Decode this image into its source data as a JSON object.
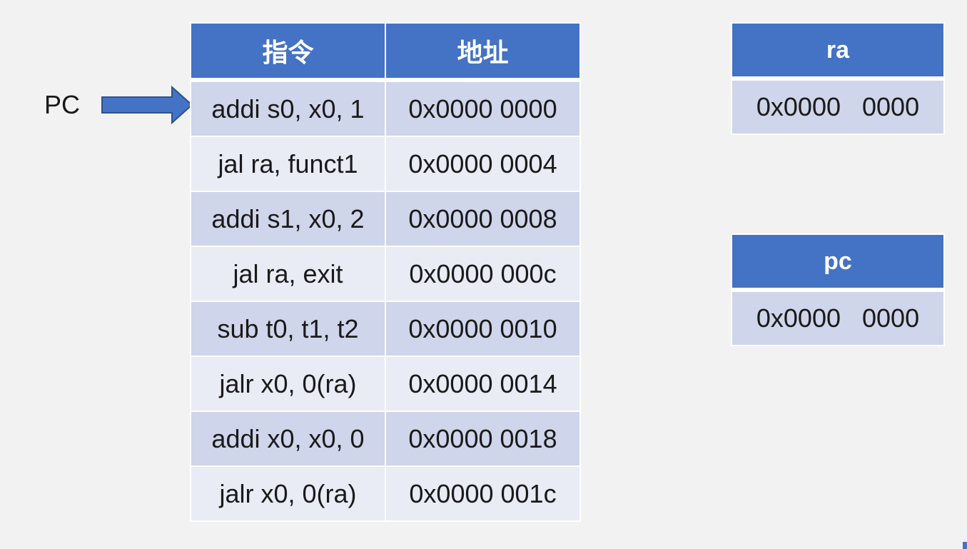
{
  "table": {
    "headers": {
      "instruction": "指令",
      "address": "地址"
    },
    "rows": [
      {
        "instruction": "addi s0, x0, 1",
        "address": "0x0000 0000"
      },
      {
        "instruction": "jal ra, funct1",
        "address": "0x0000 0004"
      },
      {
        "instruction": "addi s1, x0, 2",
        "address": "0x0000 0008"
      },
      {
        "instruction": "jal ra, exit",
        "address": "0x0000 000c"
      },
      {
        "instruction": "sub t0, t1, t2",
        "address": "0x0000 0010"
      },
      {
        "instruction": "jalr x0, 0(ra)",
        "address": "0x0000 0014"
      },
      {
        "instruction": "addi x0, x0, 0",
        "address": "0x0000 0018"
      },
      {
        "instruction": "jalr x0, 0(ra)",
        "address": "0x0000 001c"
      }
    ]
  },
  "pointer": {
    "label": "PC",
    "points_to_row": 0,
    "arrow_icon": "right-arrow-icon"
  },
  "registers": {
    "ra": {
      "name": "ra",
      "value": "0x0000   0000"
    },
    "pc": {
      "name": "pc",
      "value": "0x0000   0000"
    }
  },
  "colors": {
    "header": "#4472c4",
    "row_dark": "#cfd5ea",
    "row_light": "#e9ebf5",
    "background": "#f2f2f2"
  }
}
